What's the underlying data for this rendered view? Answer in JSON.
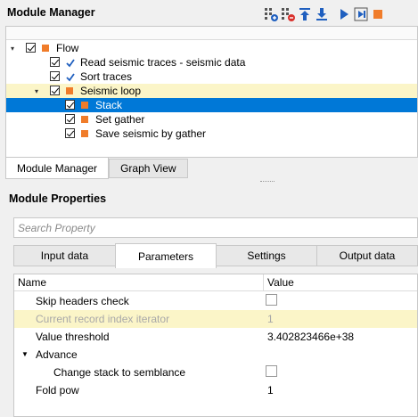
{
  "header": {
    "title": "Module Manager"
  },
  "toolbar": [
    {
      "icon": "add-module-icon"
    },
    {
      "icon": "remove-module-icon"
    },
    {
      "icon": "move-up-icon"
    },
    {
      "icon": "move-down-icon"
    },
    {
      "icon": "run-icon"
    },
    {
      "icon": "step-run-icon"
    },
    {
      "icon": "stop-icon"
    }
  ],
  "tree": {
    "items": [
      {
        "label": "Flow",
        "depth": 0,
        "checked": true,
        "marker": "square",
        "expanded": true
      },
      {
        "label": "Read seismic traces - seismic data",
        "depth": 1,
        "checked": true,
        "marker": "check"
      },
      {
        "label": "Sort traces",
        "depth": 1,
        "checked": true,
        "marker": "check"
      },
      {
        "label": "Seismic loop",
        "depth": 1,
        "checked": true,
        "marker": "square",
        "expanded": true,
        "state": "highlighted"
      },
      {
        "label": "Stack",
        "depth": 2,
        "checked": true,
        "marker": "square",
        "state": "selected"
      },
      {
        "label": "Set gather",
        "depth": 2,
        "checked": true,
        "marker": "square"
      },
      {
        "label": "Save seismic by gather",
        "depth": 2,
        "checked": true,
        "marker": "square"
      }
    ]
  },
  "bottom_tabs": [
    {
      "label": "Module Manager",
      "active": true
    },
    {
      "label": "Graph View",
      "active": false
    }
  ],
  "properties": {
    "title": "Module Properties",
    "search_placeholder": "Search Property",
    "tabs": [
      {
        "label": "Input data",
        "active": false
      },
      {
        "label": "Parameters",
        "active": true
      },
      {
        "label": "Settings",
        "active": false
      },
      {
        "label": "Output data",
        "active": false
      }
    ],
    "columns": {
      "name": "Name",
      "value": "Value"
    },
    "rows": [
      {
        "name": "Skip headers check",
        "type": "checkbox",
        "checked": false
      },
      {
        "name": "Current record index iterator",
        "value": "1",
        "disabled": true
      },
      {
        "name": "Value threshold",
        "value": "3.402823466e+38"
      },
      {
        "name": "Advance",
        "type": "group",
        "expanded": true
      },
      {
        "name": "Change stack to semblance",
        "type": "checkbox",
        "checked": false,
        "indent": true
      },
      {
        "name": "Fold pow",
        "value": "1"
      }
    ]
  },
  "colors": {
    "selection": "#0078d7",
    "highlight": "#fbf5c8",
    "accent": "#f07c2a",
    "icon_blue": "#1f5fbf"
  }
}
